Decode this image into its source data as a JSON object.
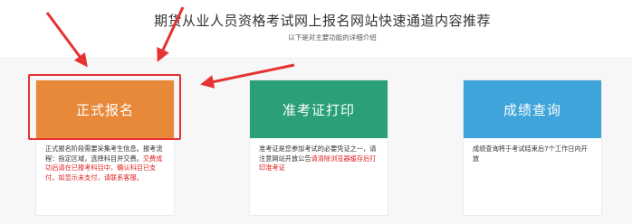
{
  "header": {
    "title": "期货从业人员资格考试网上报名网站快速通道内容推荐",
    "subtitle": "以下是对主要功能的详细介绍"
  },
  "cards": [
    {
      "label": "正式报名",
      "desc_normal": "正式报名阶段需要采集考生信息。报考流程：指定区域，选择科目并交费。",
      "desc_warning": "交费成功后请在已报考科目中，确认科目已支付。如显示未支付，请联系客服。"
    },
    {
      "label": "准考证打印",
      "desc_normal": "准考证是您参加考试的必要凭证之一，请注意网站开放公告",
      "desc_warning": "请清除浏览器缓存后打印准考证"
    },
    {
      "label": "成绩查询",
      "desc_normal": "成绩查询将于考试结束后7个工作日内开放",
      "desc_warning": ""
    }
  ],
  "colors": {
    "card1": "#e8893a",
    "card2": "#2a9f78",
    "card3": "#3ea4da",
    "highlight": "#e53232",
    "warning_text": "#e02020"
  }
}
